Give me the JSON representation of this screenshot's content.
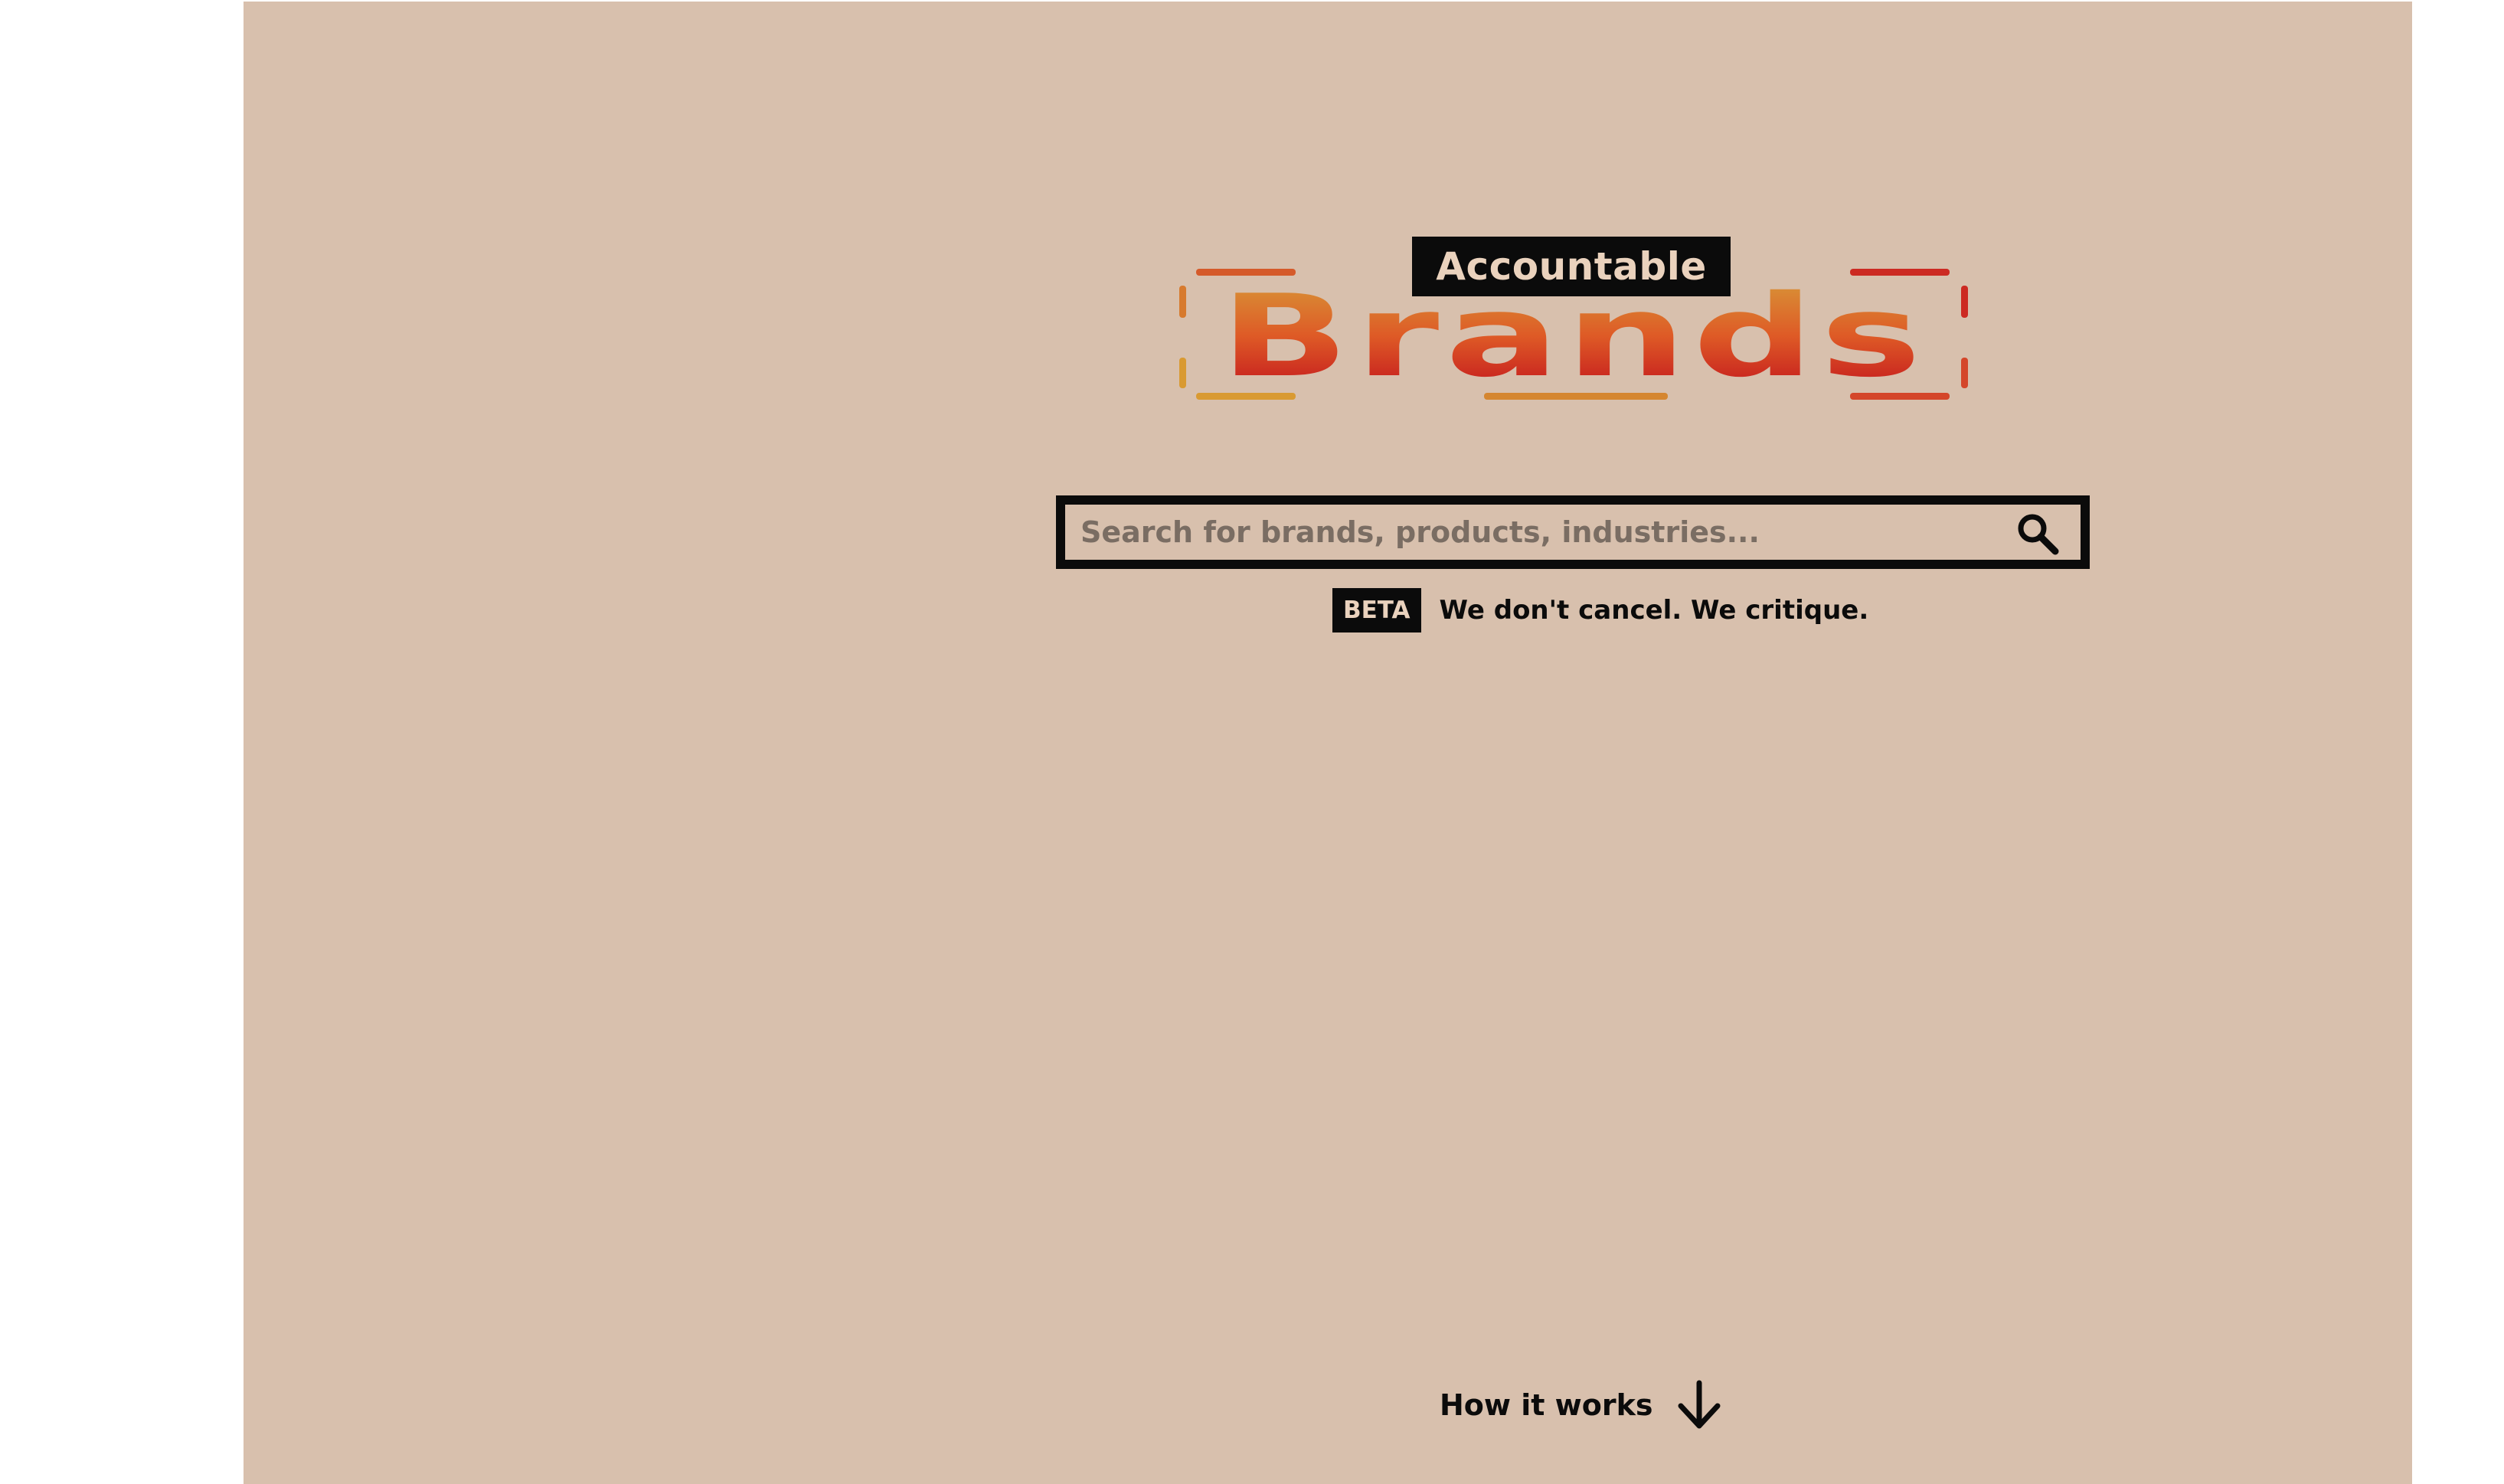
{
  "logo": {
    "tag": "Accountable",
    "wordmark": "Brands"
  },
  "search": {
    "placeholder": "Search for brands, products, industries...",
    "value": "",
    "button_icon": "search-icon"
  },
  "tagline": {
    "badge": "BETA",
    "text": "We don't cancel. We critique."
  },
  "how_it_works": {
    "label": "How it works",
    "icon": "arrow-down-icon"
  },
  "colors": {
    "background": "#d8c0ad",
    "ink": "#0b0b0b",
    "brand_gradient_top": "#d98a34",
    "brand_gradient_bottom": "#c8221f"
  }
}
